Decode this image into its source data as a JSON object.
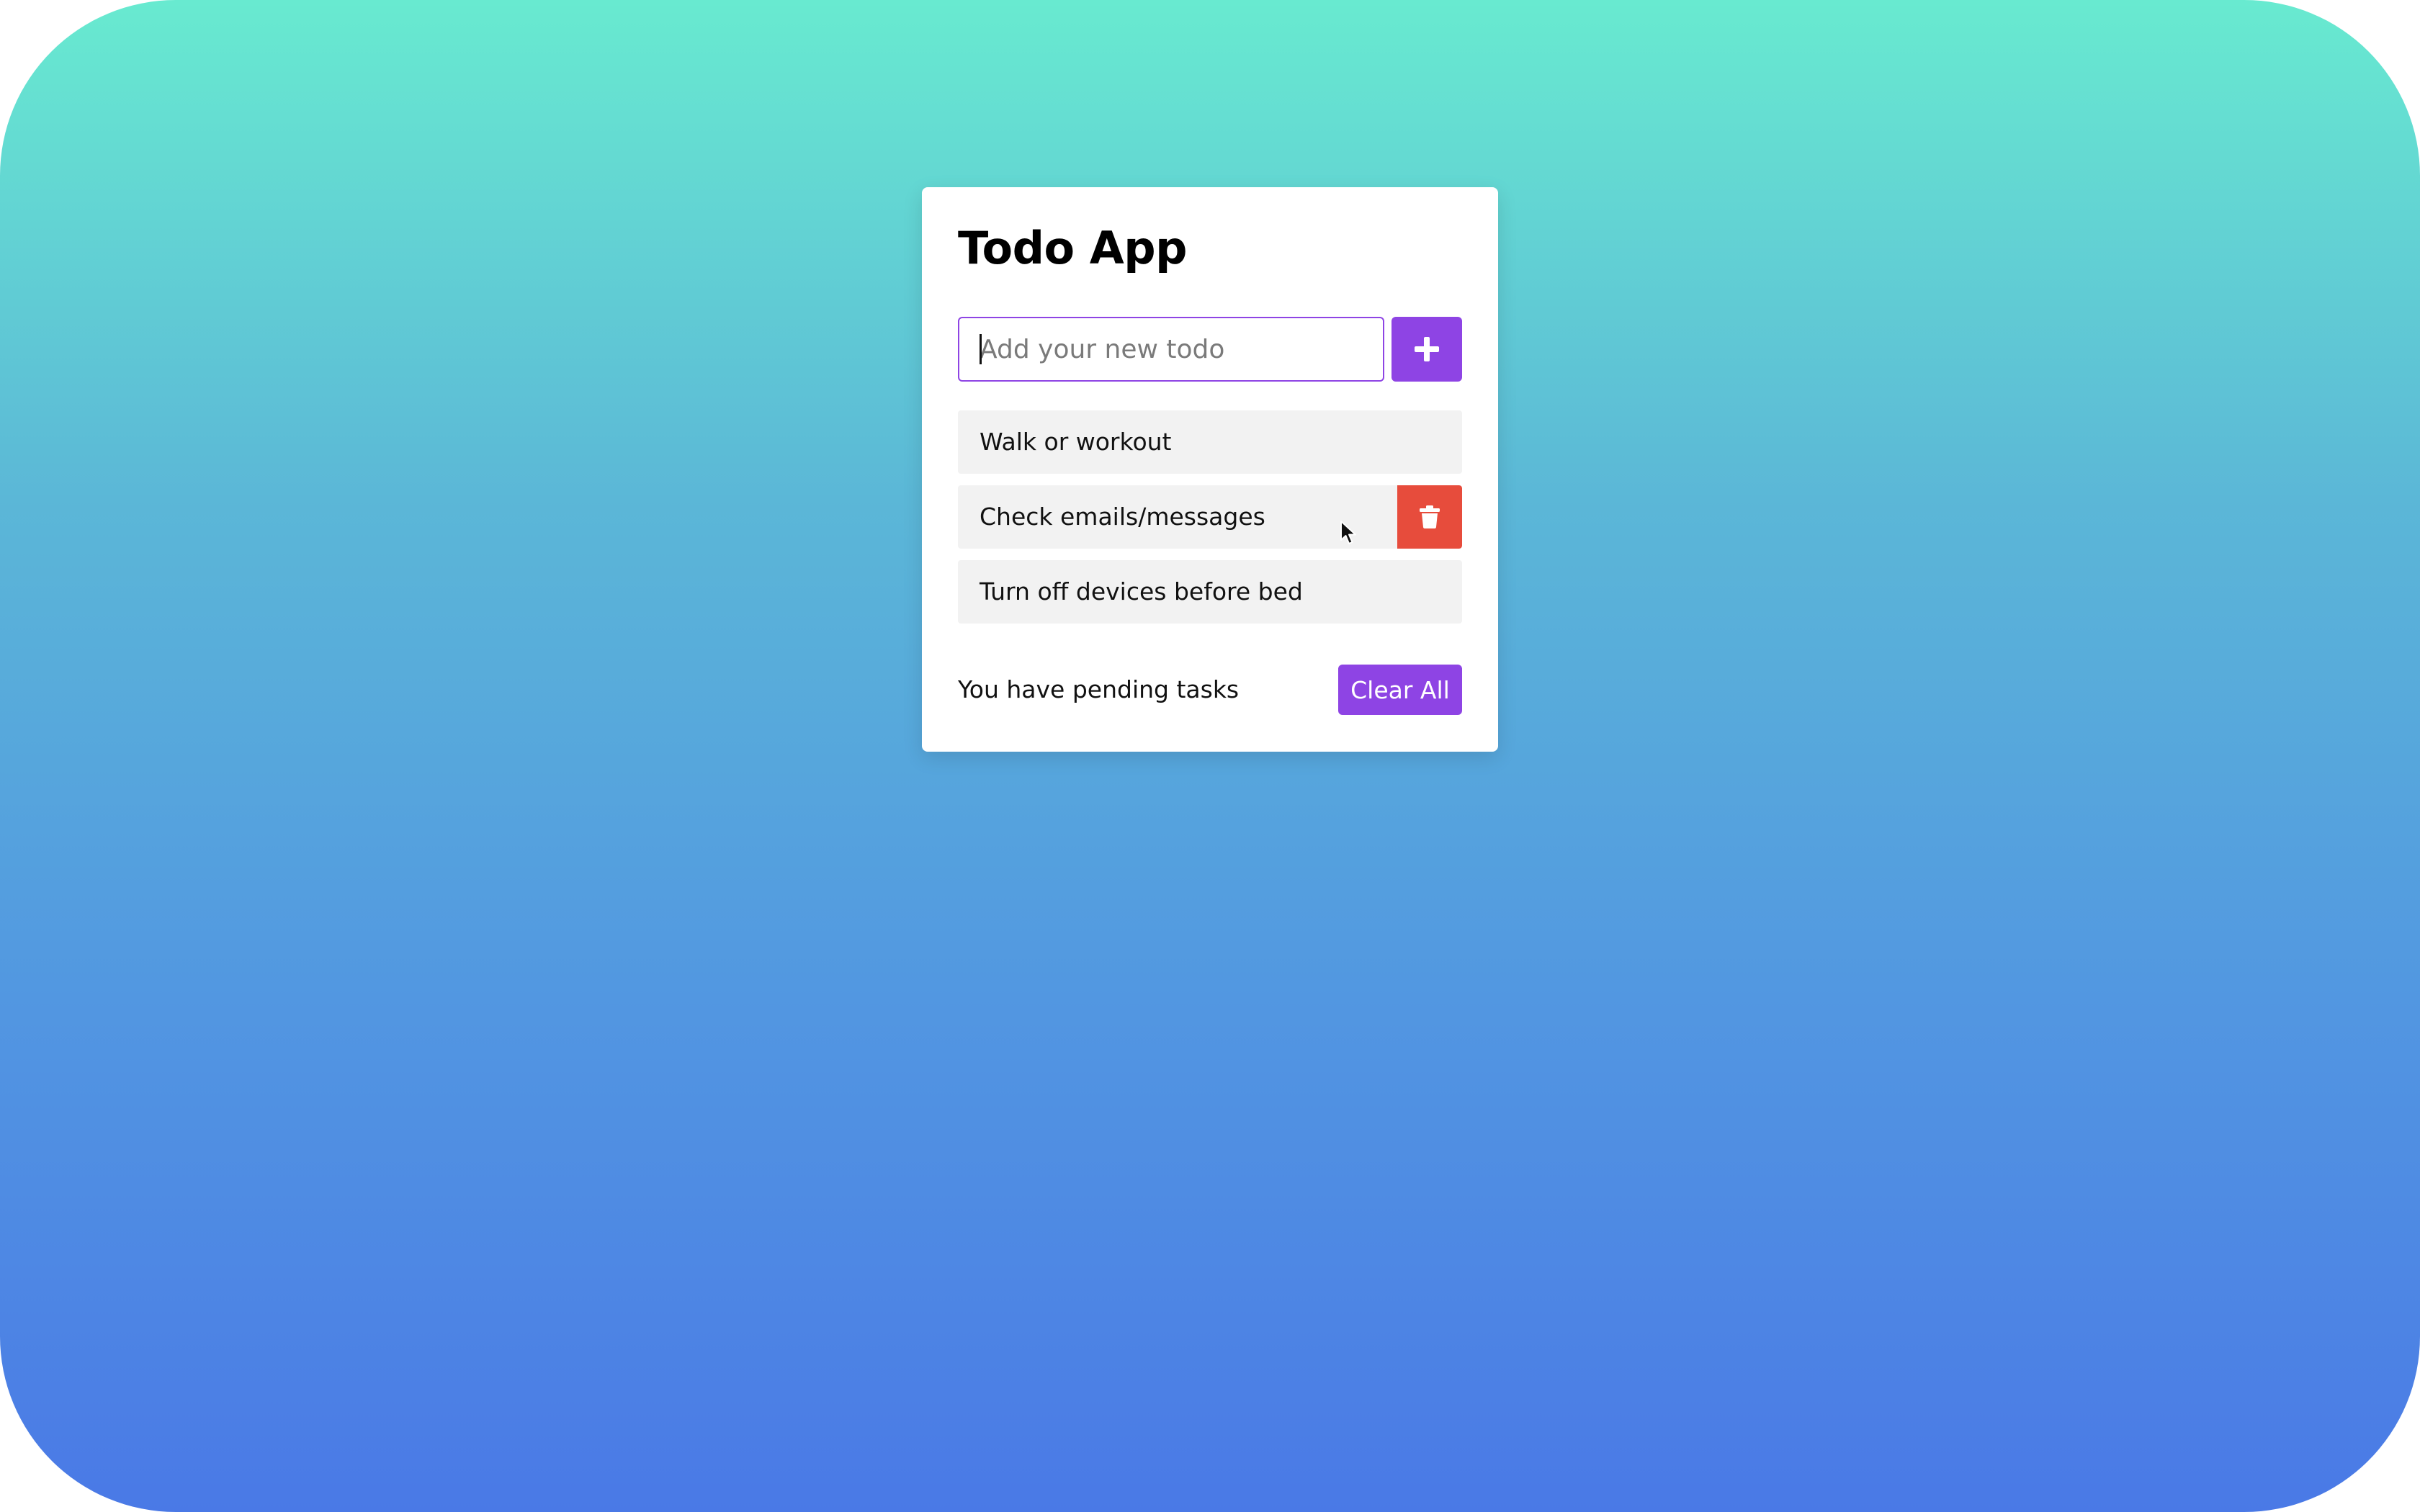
{
  "app": {
    "title": "Todo App"
  },
  "input": {
    "placeholder": "Add your new todo",
    "value": "",
    "add_button_icon": "plus-icon"
  },
  "todos": [
    {
      "text": "Walk or workout",
      "delete_visible": false
    },
    {
      "text": "Check emails/messages",
      "delete_visible": true,
      "delete_icon": "trash-icon"
    },
    {
      "text": "Turn off devices before bed",
      "delete_visible": false
    }
  ],
  "footer": {
    "pending_text": "You have pending tasks",
    "clear_button_label": "Clear All"
  },
  "colors": {
    "accent": "#8e44e4",
    "danger": "#e74c3c",
    "item_background": "#f2f2f2",
    "gradient_top": "#68ead0",
    "gradient_bottom": "#4a79e6"
  }
}
